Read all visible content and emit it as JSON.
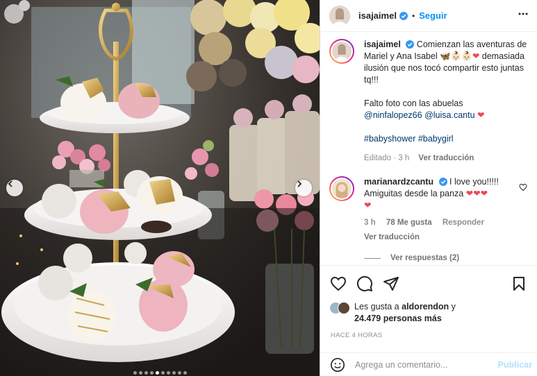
{
  "post": {
    "author": "isajaimel",
    "follow_label": "Seguir",
    "dot": "•"
  },
  "caption": {
    "author": "isajaimel",
    "line1": "Comienzan las aventuras de Mariel y Ana Isabel",
    "line2": "demasiada ilusión que nos tocó compartir esto juntas tq!!!",
    "line3": "Falto foto con las abuelas",
    "mention1": "@ninfalopez66",
    "mention2": "@luisa.cantu",
    "hashtag1": "#babyshower",
    "hashtag2": "#babygirl",
    "edited": "Editado · 3 h",
    "see_translation": "Ver traducción"
  },
  "comment": {
    "author": "marianardzcantu",
    "text1": "I love you!!!!!",
    "text2": "Amiguitas desde la panza",
    "time": "3 h",
    "likes": "78 Me gusta",
    "reply": "Responder",
    "see_translation": "Ver traducción",
    "view_replies": "Ver respuestas (2)"
  },
  "likes": {
    "prefix": "Les gusta a",
    "user": "aldorendon",
    "connector": "y",
    "count_text": "24.479 personas más"
  },
  "timestamp": "HACE 4 HORAS",
  "composer": {
    "placeholder": "Agrega un comentario...",
    "publish_label": "Publicar"
  },
  "colors": {
    "accent": "#0095f6",
    "link": "#00376b",
    "muted": "#8e8e8e",
    "heart": "#ed4956"
  },
  "carousel": {
    "slides": 10,
    "active_index": 4
  }
}
